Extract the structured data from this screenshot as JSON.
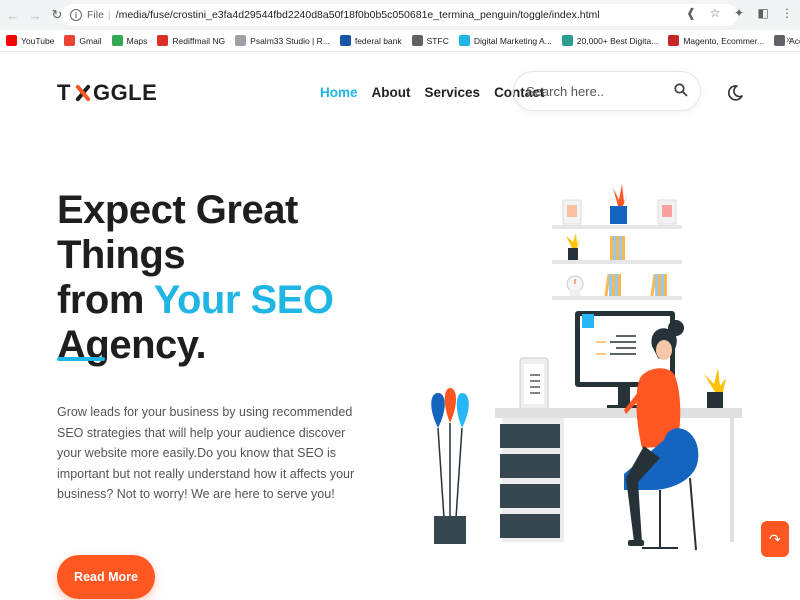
{
  "browser": {
    "url_prefix": "File",
    "url": "/media/fuse/crostini_e3fa4d29544fbd2240d8a50f18f0b0b5c050681e_termina_penguin/toggle/index.html",
    "bookmarks": [
      {
        "label": "YouTube",
        "color": "#ff0000"
      },
      {
        "label": "Gmail",
        "color": "#ea4335"
      },
      {
        "label": "Maps",
        "color": "#34a853"
      },
      {
        "label": "Rediffmail NG",
        "color": "#d93025"
      },
      {
        "label": "Psalm33 Studio | R...",
        "color": "#9aa0a6"
      },
      {
        "label": "federal bank",
        "color": "#1a56a6"
      },
      {
        "label": "STFC",
        "color": "#5f6368"
      },
      {
        "label": "Digital Marketing A...",
        "color": "#1fb6e6"
      },
      {
        "label": "20,000+ Best Digita...",
        "color": "#2a9d8f"
      },
      {
        "label": "Magento, Ecommer...",
        "color": "#c62828"
      },
      {
        "label": "Accolades Media –...",
        "color": "#5f6368"
      }
    ],
    "more": "»"
  },
  "header": {
    "logo_left": "T",
    "logo_right": "GGLE",
    "nav": [
      {
        "label": "Home",
        "active": true
      },
      {
        "label": "About",
        "active": false
      },
      {
        "label": "Services",
        "active": false
      },
      {
        "label": "Contact",
        "active": false
      }
    ],
    "search_placeholder": "Search here.."
  },
  "hero": {
    "title_line1": "Expect Great Things",
    "title_line2_prefix": "from ",
    "title_accent": "Your SEO",
    "title_line3": "Agency.",
    "body": "Grow leads for your business by using recommended SEO strategies that will help your audience discover your website more easily.Do you know that SEO is important but not really understand how it affects your business? Not to worry! We are here to serve you!",
    "cta": "Read More"
  },
  "colors": {
    "accent": "#1fb6e6",
    "cta": "#ff5722",
    "text": "#1e1e1e"
  }
}
